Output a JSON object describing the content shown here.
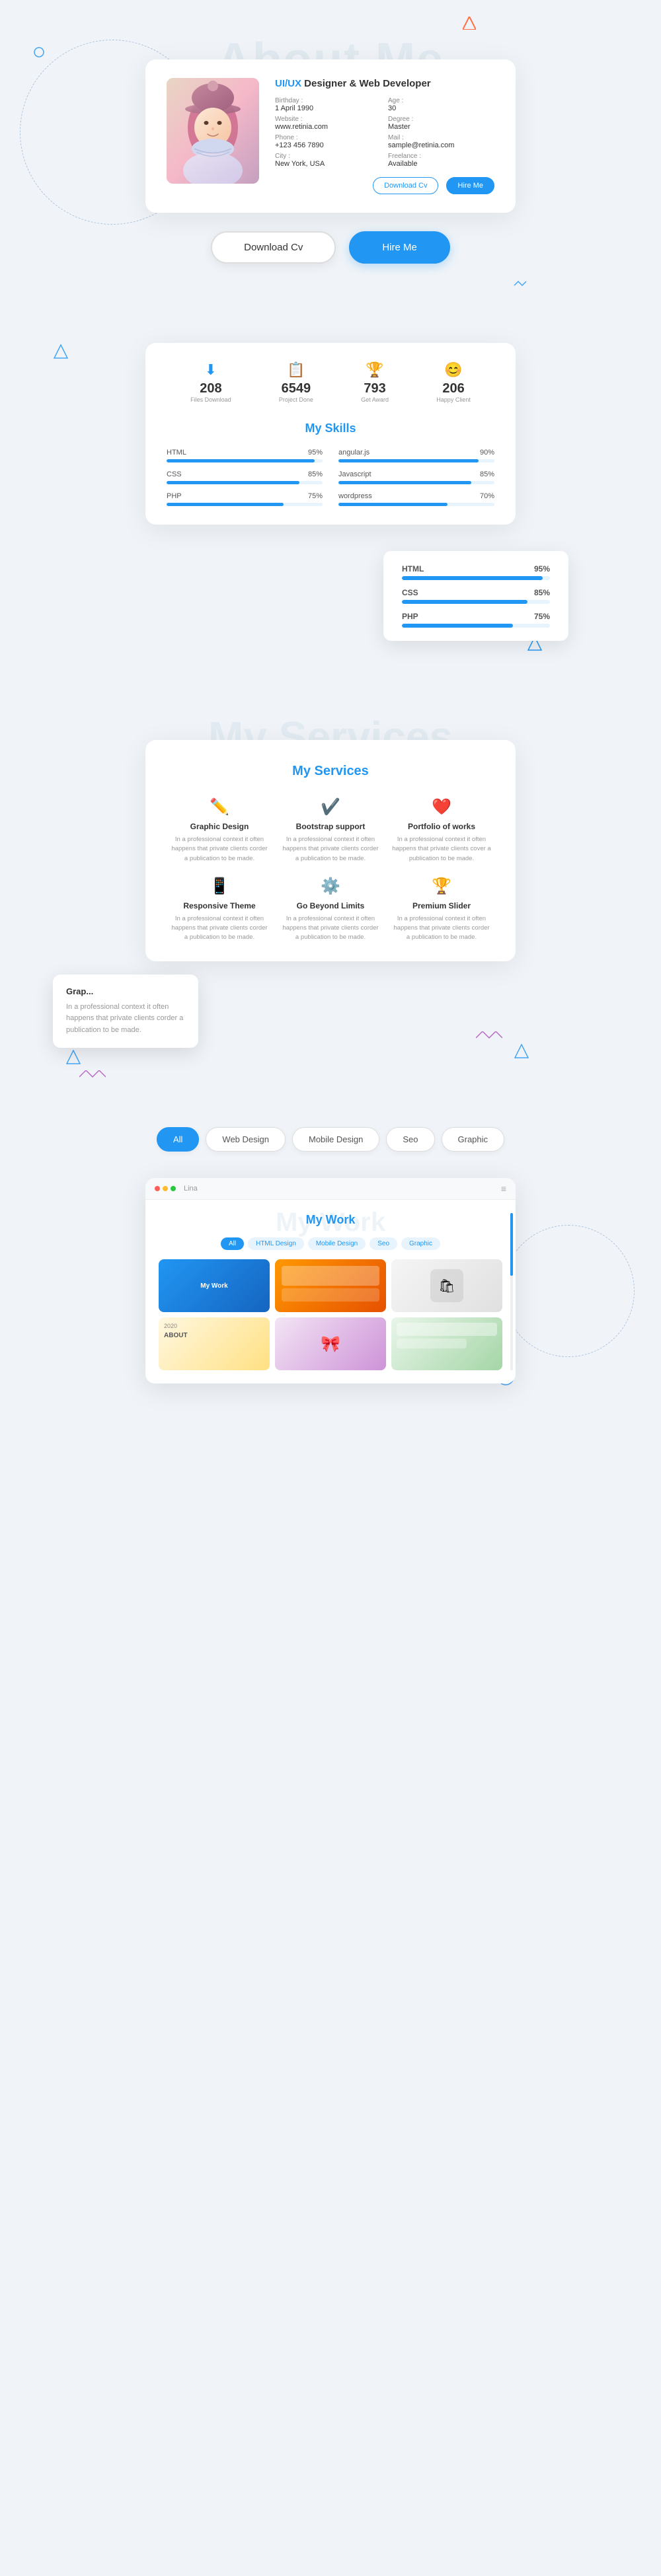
{
  "about": {
    "title_bg": "About Me",
    "title_fg": "About Me",
    "subtitle": "UI/UX Designer & Web Developer",
    "subtitle_highlight": "UI/UX",
    "fields": [
      {
        "label": "Birthday :",
        "value": "1 April 1990"
      },
      {
        "label": "Age :",
        "value": "30"
      },
      {
        "label": "Website :",
        "value": "www.retinia.com"
      },
      {
        "label": "Degree :",
        "value": "Master"
      },
      {
        "label": "Phone :",
        "value": "+123 456 7890"
      },
      {
        "label": "Mail :",
        "value": "sample@retinia.com"
      },
      {
        "label": "City :",
        "value": "New York, USA"
      },
      {
        "label": "Freelance :",
        "value": "Available"
      }
    ],
    "btn_download_small": "Download Cv",
    "btn_hire_small": "Hire Me",
    "btn_download_large": "Download Cv",
    "btn_hire_large": "Hire Me"
  },
  "stats": [
    {
      "icon": "⬇",
      "number": "208",
      "label": "Files Download"
    },
    {
      "icon": "📋",
      "number": "6549",
      "label": "Project Done"
    },
    {
      "icon": "🏆",
      "number": "793",
      "label": "Get Award"
    },
    {
      "icon": "😊",
      "number": "206",
      "label": "Happy Client"
    }
  ],
  "skills": {
    "title": "My Skills",
    "items": [
      {
        "name": "HTML",
        "percent": 95
      },
      {
        "name": "angular.js",
        "percent": 90
      },
      {
        "name": "CSS",
        "percent": 85
      },
      {
        "name": "Javascript",
        "percent": 85
      },
      {
        "name": "PHP",
        "percent": 75
      },
      {
        "name": "wordpress",
        "percent": 70
      }
    ],
    "float_items": [
      {
        "name": "HTML",
        "percent": 95
      },
      {
        "name": "CSS",
        "percent": 85
      },
      {
        "name": "PHP",
        "percent": 75
      }
    ]
  },
  "services": {
    "title_bg": "My Services",
    "title_fg": "My Services",
    "items": [
      {
        "icon": "✏",
        "name": "Graphic Design",
        "desc": "In a professional context it often happens that private clients corder a publication to be made."
      },
      {
        "icon": "✓",
        "name": "Bootstrap support",
        "desc": "In a professional context it often happens that private clients corder a publication to be made."
      },
      {
        "icon": "❤",
        "name": "Portfolio of works",
        "desc": "In a professional context it often happens that private clients cover a publication to be made."
      },
      {
        "icon": "📱",
        "name": "Responsive Theme",
        "desc": "In a professional context it often happens that private clients corder a publication to be made."
      },
      {
        "icon": "⚙",
        "name": "Go Beyond Limits",
        "desc": "In a professional context it often happens that private clients corder a publication to be made."
      },
      {
        "icon": "🏆",
        "name": "Premium Slider",
        "desc": "In a professional context it often happens that private clients corder a publication to be made."
      }
    ],
    "tooltip_title": "Grap...",
    "tooltip_desc": "In a professional context it often happens that private clients corder a publication to be made."
  },
  "work": {
    "title_bg": "My Work",
    "title_fg": "My Work",
    "filter_buttons": [
      {
        "label": "All",
        "active": true
      },
      {
        "label": "Web Design",
        "active": false
      },
      {
        "label": "Mobile Design",
        "active": false
      },
      {
        "label": "Seo",
        "active": false
      },
      {
        "label": "Graphic",
        "active": false
      }
    ],
    "browser_label": "Lina",
    "work_filter": [
      {
        "label": "All",
        "active": true
      },
      {
        "label": "HTML Design",
        "active": false
      },
      {
        "label": "Mobile Design",
        "active": false
      },
      {
        "label": "Seo",
        "active": false
      },
      {
        "label": "Graphic",
        "active": false
      }
    ],
    "items": [
      {
        "label": "My Work",
        "style": 1
      },
      {
        "label": "",
        "style": 2
      },
      {
        "label": "",
        "style": 3
      },
      {
        "label": "",
        "style": 4
      },
      {
        "label": "",
        "style": 5
      },
      {
        "label": "",
        "style": 6
      }
    ]
  }
}
